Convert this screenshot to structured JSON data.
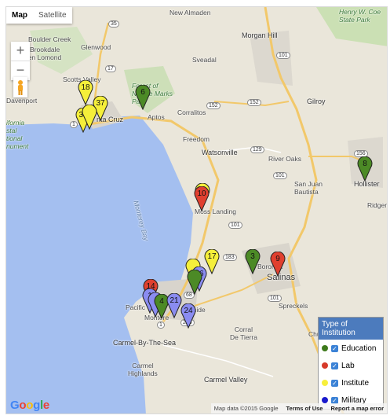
{
  "controls": {
    "map": "Map",
    "satellite": "Satellite",
    "zoom_in": "+",
    "zoom_out": "−"
  },
  "places": {
    "new_almaden": "New Almaden",
    "boulder_creek": "Boulder Creek",
    "glenwood": "Glenwood",
    "brookdale": "Brookdale",
    "ben_lomond": "Ben Lomond",
    "scotts_valley": "Scotts Valley",
    "davenport": "Davenport",
    "santa_cruz": "nta Cruz",
    "aptos": "Aptos",
    "corralitos": "Corralitos",
    "morgan_hill": "Morgan Hill",
    "sveadal": "Sveadal",
    "gilroy": "Gilroy",
    "freedom": "Freedom",
    "watsonville": "Watsonville",
    "river_oaks": "River Oaks",
    "san_juan_bautista": "San Juan\nBautista",
    "hollister": "Hollister",
    "ridgemark": "Ridgem",
    "henry_coe": "Henry W. Coe\nState Park",
    "forest_nisene": "Forest of\nNisene Marks\nPark",
    "california_coastal": "ifornia\nstal\ntional\nnument",
    "moss_landing": "Moss Landing",
    "monterey_bay": "Monterey Bay",
    "boronda": "Boronda",
    "salinas": "Salinas",
    "spreckels": "Spreckels",
    "pacific_grove": "Pacific Gr",
    "monterey": "Montere",
    "seaside": "Seaside",
    "corral_de_tierra": "Corral\nDe Tierra",
    "carmel_by_the_sea": "Carmel-By-The-Sea",
    "carmel_highlands": "Carmel\nHighlands",
    "carmel_valley": "Carmel Valley",
    "chualar": "Chu"
  },
  "shields": [
    "9",
    "35",
    "17",
    "101",
    "152",
    "152",
    "129",
    "101",
    "156",
    "101",
    "183",
    "101",
    "1",
    "218",
    "68",
    "1"
  ],
  "markers": [
    {
      "label": "18",
      "type": "Institute"
    },
    {
      "label": "37",
      "type": "Institute"
    },
    {
      "label": "33",
      "type": "Institute"
    },
    {
      "label": "",
      "type": "Institute"
    },
    {
      "label": "6",
      "type": "Education"
    },
    {
      "label": "8",
      "type": "Education"
    },
    {
      "label": "",
      "type": "Institute"
    },
    {
      "label": "10",
      "type": "Lab"
    },
    {
      "label": "17",
      "type": "Institute"
    },
    {
      "label": "",
      "type": "Institute"
    },
    {
      "label": "3",
      "type": "Education"
    },
    {
      "label": "9",
      "type": "Lab"
    },
    {
      "label": "26",
      "type": "Military"
    },
    {
      "label": "",
      "type": "Education"
    },
    {
      "label": "14",
      "type": "Lab"
    },
    {
      "label": "1",
      "type": "Military"
    },
    {
      "label": "",
      "type": "Military"
    },
    {
      "label": "4",
      "type": "Education"
    },
    {
      "label": "21",
      "type": "Military"
    },
    {
      "label": "24",
      "type": "Military"
    }
  ],
  "legend": {
    "title": "Type of Institution",
    "items": [
      {
        "label": "Education",
        "color": "#3e7a1c",
        "checked": true
      },
      {
        "label": "Lab",
        "color": "#d63a2a",
        "checked": true
      },
      {
        "label": "Institute",
        "color": "#f7ef3c",
        "checked": true
      },
      {
        "label": "Military",
        "color": "#1a1acc",
        "checked": true
      }
    ]
  },
  "colors": {
    "Education": "#4c8a26",
    "Lab": "#e0402f",
    "Institute": "#f5ef3a",
    "Military": "#8a8cf0"
  },
  "footer": {
    "data": "Map data ©2015 Google",
    "terms": "Terms of Use",
    "report": "Report a map error"
  },
  "google_logo": "Google"
}
